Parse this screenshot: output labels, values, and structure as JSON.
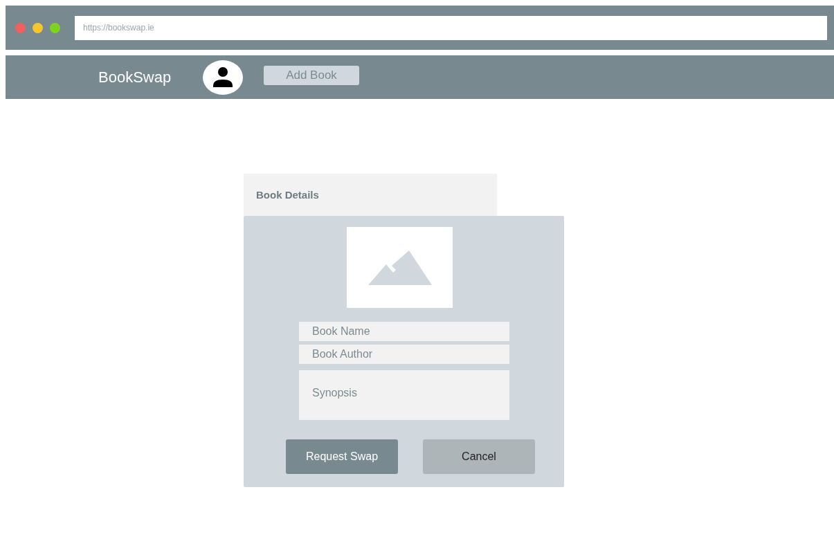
{
  "browser": {
    "dots": [
      {
        "color": "#f0605e"
      },
      {
        "color": "#f8c52c"
      },
      {
        "color": "#7ed321"
      }
    ],
    "address": "https://bookswap.ie"
  },
  "navbar": {
    "logo": "BookSwap",
    "action": "Add Book"
  },
  "panel": {
    "tab": "Book Details",
    "image": {
      "kind": "placeholder"
    },
    "fields": [
      {
        "kind": "text",
        "placeholder": "Book Name"
      },
      {
        "kind": "text",
        "placeholder": "Book Author"
      },
      {
        "kind": "textarea",
        "placeholder": "Synopsis"
      }
    ],
    "buttons": [
      {
        "kind": "primary",
        "label": "Request Swap"
      },
      {
        "kind": "secondary",
        "label": "Cancel"
      }
    ]
  }
}
